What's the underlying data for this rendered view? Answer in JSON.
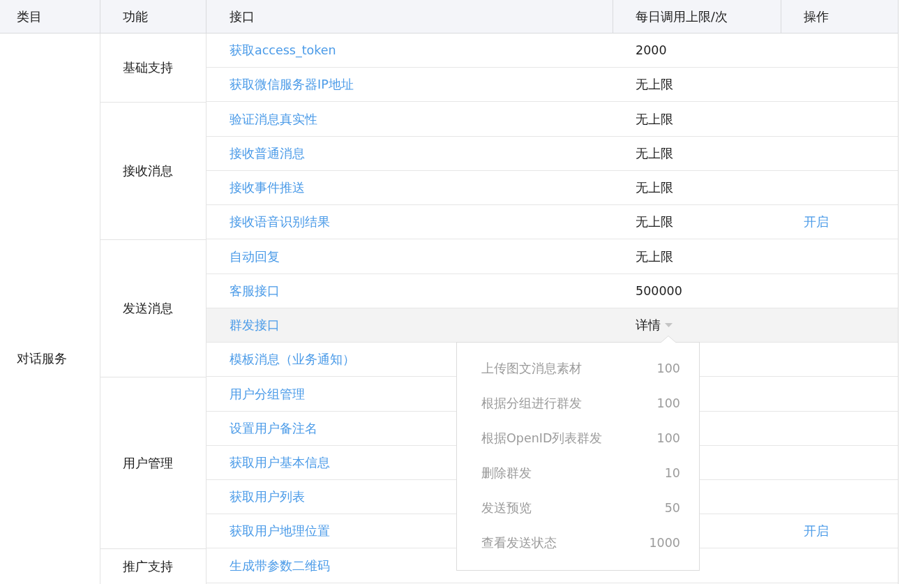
{
  "table": {
    "columns": [
      "类目",
      "功能",
      "接口",
      "每日调用上限/次",
      "操作"
    ],
    "categories": [
      {
        "name": "对话服务",
        "groups": [
          {
            "name": "基础支持",
            "rows": [
              {
                "interface": "获取access_token",
                "limit": "2000",
                "highlighted": false,
                "kind": "plain"
              },
              {
                "interface": "获取微信服务器IP地址",
                "limit": "无上限",
                "highlighted": false,
                "kind": "plain"
              }
            ]
          },
          {
            "name": "接收消息",
            "rows": [
              {
                "interface": "验证消息真实性",
                "limit": "无上限",
                "highlighted": false,
                "kind": "plain"
              },
              {
                "interface": "接收普通消息",
                "limit": "无上限",
                "highlighted": false,
                "kind": "plain"
              },
              {
                "interface": "接收事件推送",
                "limit": "无上限",
                "highlighted": false,
                "kind": "plain"
              },
              {
                "interface": "接收语音识别结果",
                "limit": "无上限",
                "highlighted": false,
                "kind": "plain",
                "action": "开启"
              }
            ]
          },
          {
            "name": "发送消息",
            "rows": [
              {
                "interface": "自动回复",
                "limit": "无上限",
                "highlighted": false,
                "kind": "plain"
              },
              {
                "interface": "客服接口",
                "limit": "500000",
                "highlighted": false,
                "kind": "plain"
              },
              {
                "interface": "群发接口",
                "limit": "详情",
                "highlighted": true,
                "kind": "dropdown",
                "expanded": true,
                "details": [
                  {
                    "name": "上传图文消息素材",
                    "limit": "100"
                  },
                  {
                    "name": "根据分组进行群发",
                    "limit": "100"
                  },
                  {
                    "name": "根据OpenID列表群发",
                    "limit": "100"
                  },
                  {
                    "name": "删除群发",
                    "limit": "10"
                  },
                  {
                    "name": "发送预览",
                    "limit": "50"
                  },
                  {
                    "name": "查看发送状态",
                    "limit": "1000"
                  }
                ]
              },
              {
                "interface": "模板消息（业务通知）",
                "highlighted": false,
                "kind": "plain"
              }
            ]
          },
          {
            "name": "用户管理",
            "rows": [
              {
                "interface": "用户分组管理",
                "highlighted": false,
                "kind": "plain"
              },
              {
                "interface": "设置用户备注名",
                "highlighted": false,
                "kind": "plain"
              },
              {
                "interface": "获取用户基本信息",
                "highlighted": false,
                "kind": "plain"
              },
              {
                "interface": "获取用户列表",
                "highlighted": false,
                "kind": "plain"
              },
              {
                "interface": "获取用户地理位置",
                "highlighted": false,
                "kind": "plain",
                "action": "开启"
              }
            ]
          },
          {
            "name": "推广支持",
            "rows": [
              {
                "interface": "生成带参数二维码",
                "highlighted": false,
                "kind": "plain"
              }
            ]
          }
        ]
      }
    ]
  }
}
